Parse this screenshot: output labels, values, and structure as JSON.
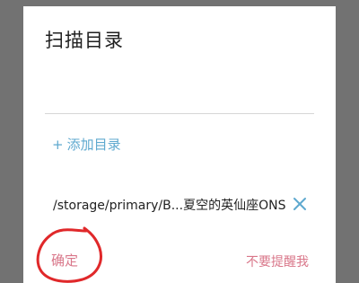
{
  "dialog": {
    "title": "扫描目录",
    "add_directory": "添加目录",
    "add_prefix": "+",
    "directory_path": "/storage/primary/B...夏空的英仙座ONS",
    "confirm_label": "确定",
    "dont_remind_label": "不要提醒我"
  },
  "icons": {
    "remove": "close-icon",
    "annotation": "red-hand-drawn-circle"
  },
  "colors": {
    "accent_blue": "#5fa9cf",
    "accent_pink": "#d9778a",
    "annotation_red": "#e0282a",
    "backdrop": "#727272"
  }
}
